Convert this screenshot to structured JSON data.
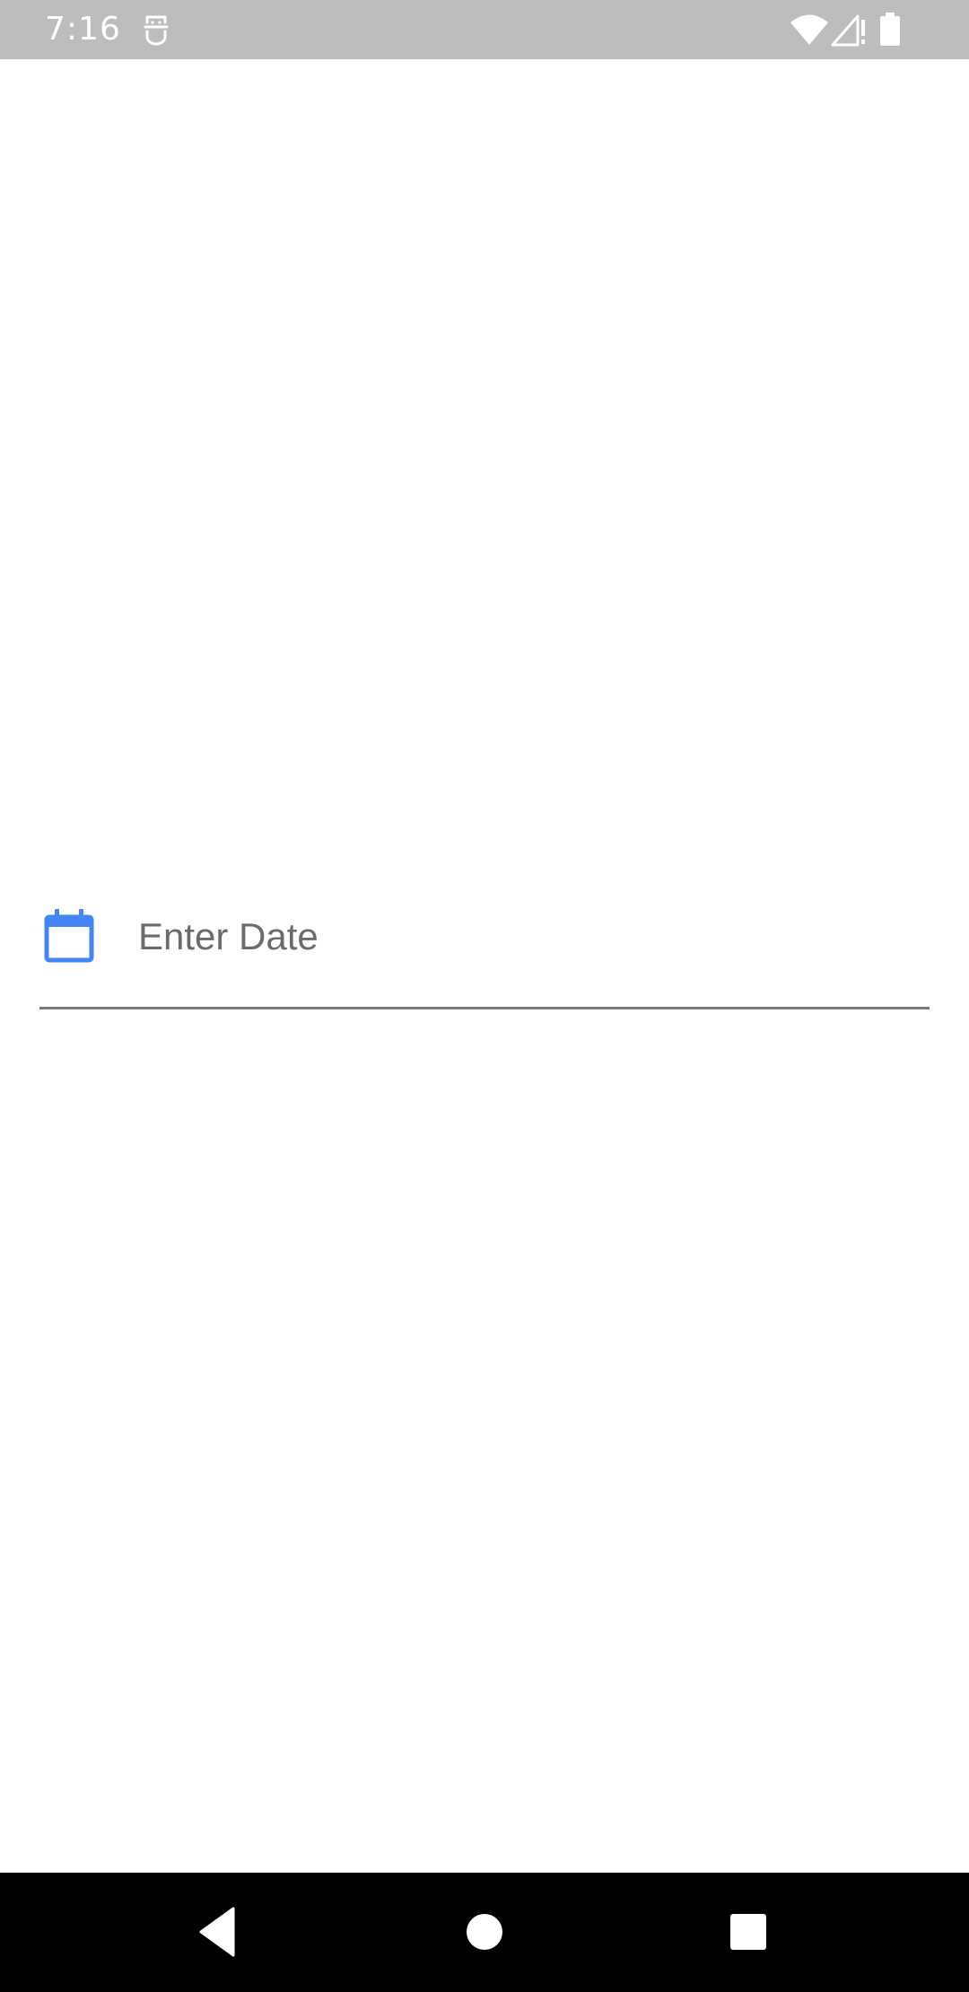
{
  "status_bar": {
    "time": "7:16",
    "app_icon": "accessibility-app-icon",
    "icons": [
      "wifi-icon",
      "signal-icon",
      "battery-icon"
    ],
    "background": "#bdbdbd"
  },
  "form": {
    "date_field": {
      "placeholder": "Enter Date",
      "value": "",
      "icon": "calendar-icon",
      "icon_color": "#4285f4"
    }
  },
  "nav_bar": {
    "buttons": [
      "back",
      "home",
      "recents"
    ],
    "background": "#000000"
  }
}
